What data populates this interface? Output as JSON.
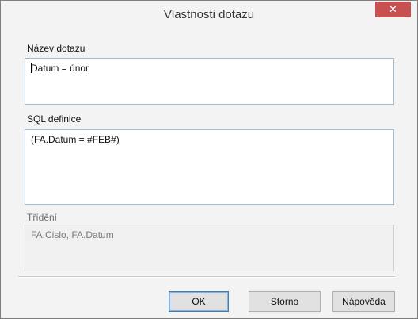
{
  "dialog": {
    "title": "Vlastnosti dotazu",
    "close_icon": "close-icon",
    "close_glyph": "✕"
  },
  "query_name": {
    "label": "Název dotazu",
    "value": "Datum = únor"
  },
  "sql_definition": {
    "label": "SQL definice",
    "value": "(FA.Datum = #FEB#)"
  },
  "sorting": {
    "label": "Třídění",
    "value": "FA.Cislo, FA.Datum"
  },
  "buttons": {
    "ok": "OK",
    "cancel": "Storno",
    "help_mnemonic": "N",
    "help_rest": "ápověda"
  },
  "colors": {
    "close_button": "#c75050",
    "field_border": "#a6b8cc",
    "default_button_border": "#3c7fb1"
  }
}
